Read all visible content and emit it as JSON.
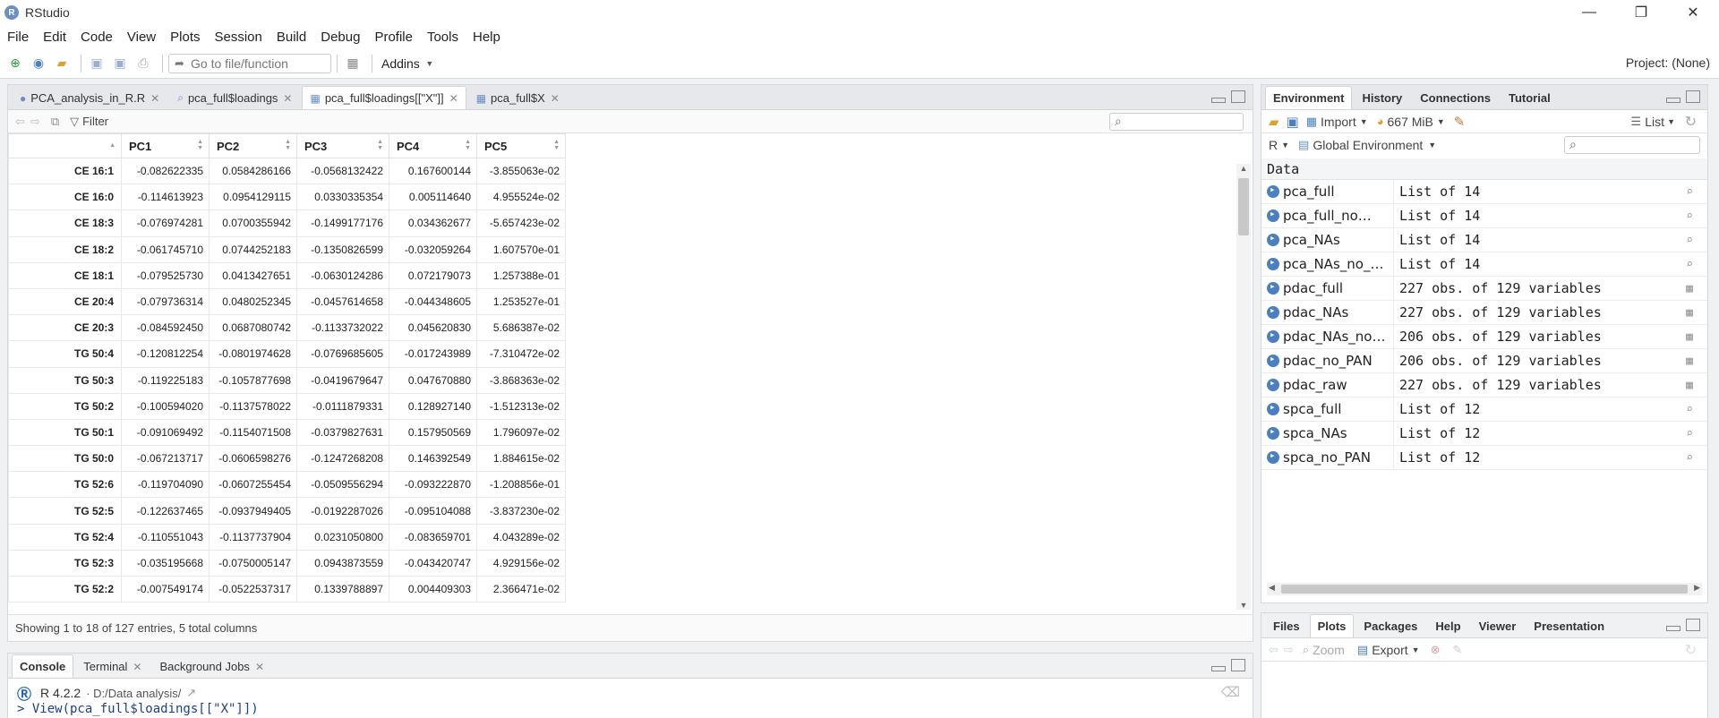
{
  "app": {
    "title": "RStudio",
    "logo_letter": "R"
  },
  "window_controls": {
    "minimize": "—",
    "maximize": "❐",
    "close": "✕"
  },
  "menu": [
    "File",
    "Edit",
    "Code",
    "View",
    "Plots",
    "Session",
    "Build",
    "Debug",
    "Profile",
    "Tools",
    "Help"
  ],
  "toolbar": {
    "goto_placeholder": "Go to file/function",
    "addins": "Addins",
    "project": "Project: (None)"
  },
  "source": {
    "tabs": [
      {
        "label": "PCA_analysis_in_R.R",
        "icon": "R"
      },
      {
        "label": "pca_full$loadings",
        "icon": "⌕"
      },
      {
        "label": "pca_full$loadings[[\"X\"]]",
        "icon": "▦"
      },
      {
        "label": "pca_full$X",
        "icon": "▦"
      }
    ],
    "filter_label": "Filter",
    "columns": [
      "PC1",
      "PC2",
      "PC3",
      "PC4",
      "PC5"
    ],
    "rows": [
      {
        "name": "CE 16:1",
        "v": [
          "-0.082622335",
          "0.0584286166",
          "-0.0568132422",
          "0.167600144",
          "-3.855063e-02"
        ]
      },
      {
        "name": "CE 16:0",
        "v": [
          "-0.114613923",
          "0.0954129115",
          "0.0330335354",
          "0.005114640",
          "4.955524e-02"
        ]
      },
      {
        "name": "CE 18:3",
        "v": [
          "-0.076974281",
          "0.0700355942",
          "-0.1499177176",
          "0.034362677",
          "-5.657423e-02"
        ]
      },
      {
        "name": "CE 18:2",
        "v": [
          "-0.061745710",
          "0.0744252183",
          "-0.1350826599",
          "-0.032059264",
          "1.607570e-01"
        ]
      },
      {
        "name": "CE 18:1",
        "v": [
          "-0.079525730",
          "0.0413427651",
          "-0.0630124286",
          "0.072179073",
          "1.257388e-01"
        ]
      },
      {
        "name": "CE 20:4",
        "v": [
          "-0.079736314",
          "0.0480252345",
          "-0.0457614658",
          "-0.044348605",
          "1.253527e-01"
        ]
      },
      {
        "name": "CE 20:3",
        "v": [
          "-0.084592450",
          "0.0687080742",
          "-0.1133732022",
          "0.045620830",
          "5.686387e-02"
        ]
      },
      {
        "name": "TG 50:4",
        "v": [
          "-0.120812254",
          "-0.0801974628",
          "-0.0769685605",
          "-0.017243989",
          "-7.310472e-02"
        ]
      },
      {
        "name": "TG 50:3",
        "v": [
          "-0.119225183",
          "-0.1057877698",
          "-0.0419679647",
          "0.047670880",
          "-3.868363e-02"
        ]
      },
      {
        "name": "TG 50:2",
        "v": [
          "-0.100594020",
          "-0.1137578022",
          "-0.0111879331",
          "0.128927140",
          "-1.512313e-02"
        ]
      },
      {
        "name": "TG 50:1",
        "v": [
          "-0.091069492",
          "-0.1154071508",
          "-0.0379827631",
          "0.157950569",
          "1.796097e-02"
        ]
      },
      {
        "name": "TG 50:0",
        "v": [
          "-0.067213717",
          "-0.0606598276",
          "-0.1247268208",
          "0.146392549",
          "1.884615e-02"
        ]
      },
      {
        "name": "TG 52:6",
        "v": [
          "-0.119704090",
          "-0.0607255454",
          "-0.0509556294",
          "-0.093222870",
          "-1.208856e-01"
        ]
      },
      {
        "name": "TG 52:5",
        "v": [
          "-0.122637465",
          "-0.0937949405",
          "-0.0192287026",
          "-0.095104088",
          "-3.837230e-02"
        ]
      },
      {
        "name": "TG 52:4",
        "v": [
          "-0.110551043",
          "-0.1137737904",
          "0.0231050800",
          "-0.083659701",
          "4.043289e-02"
        ]
      },
      {
        "name": "TG 52:3",
        "v": [
          "-0.035195668",
          "-0.0750005147",
          "0.0943873559",
          "-0.043420747",
          "4.929156e-02"
        ]
      },
      {
        "name": "TG 52:2",
        "v": [
          "-0.007549174",
          "-0.0522537317",
          "0.1339788897",
          "0.004409303",
          "2.366471e-02"
        ]
      }
    ],
    "status": "Showing 1 to 18 of 127 entries, 5 total columns"
  },
  "console": {
    "tabs": [
      "Console",
      "Terminal",
      "Background Jobs"
    ],
    "r_version": "R 4.2.2",
    "path": "· D:/Data analysis/",
    "last_command": "> View(pca_full$loadings[[\"X\"]])"
  },
  "environment": {
    "tabs": [
      "Environment",
      "History",
      "Connections",
      "Tutorial"
    ],
    "import_label": "Import",
    "memory": "667 MiB",
    "view_mode": "List",
    "language": "R",
    "scope": "Global Environment",
    "section": "Data",
    "items": [
      {
        "name": "pca_full",
        "value": "List of  14",
        "kind": "list"
      },
      {
        "name": "pca_full_no…",
        "value": "List of  14",
        "kind": "list"
      },
      {
        "name": "pca_NAs",
        "value": "List of  14",
        "kind": "list"
      },
      {
        "name": "pca_NAs_no_…",
        "value": "List of  14",
        "kind": "list"
      },
      {
        "name": "pdac_full",
        "value": "227 obs. of 129 variables",
        "kind": "df"
      },
      {
        "name": "pdac_NAs",
        "value": "227 obs. of 129 variables",
        "kind": "df"
      },
      {
        "name": "pdac_NAs_no…",
        "value": "206 obs. of 129 variables",
        "kind": "df"
      },
      {
        "name": "pdac_no_PAN",
        "value": "206 obs. of 129 variables",
        "kind": "df"
      },
      {
        "name": "pdac_raw",
        "value": "227 obs. of 129 variables",
        "kind": "df"
      },
      {
        "name": "spca_full",
        "value": "List of  12",
        "kind": "list"
      },
      {
        "name": "spca_NAs",
        "value": "List of  12",
        "kind": "list"
      },
      {
        "name": "spca_no_PAN",
        "value": "List of  12",
        "kind": "list"
      }
    ]
  },
  "files": {
    "tabs": [
      "Files",
      "Plots",
      "Packages",
      "Help",
      "Viewer",
      "Presentation"
    ],
    "zoom_label": "Zoom",
    "export_label": "Export"
  }
}
